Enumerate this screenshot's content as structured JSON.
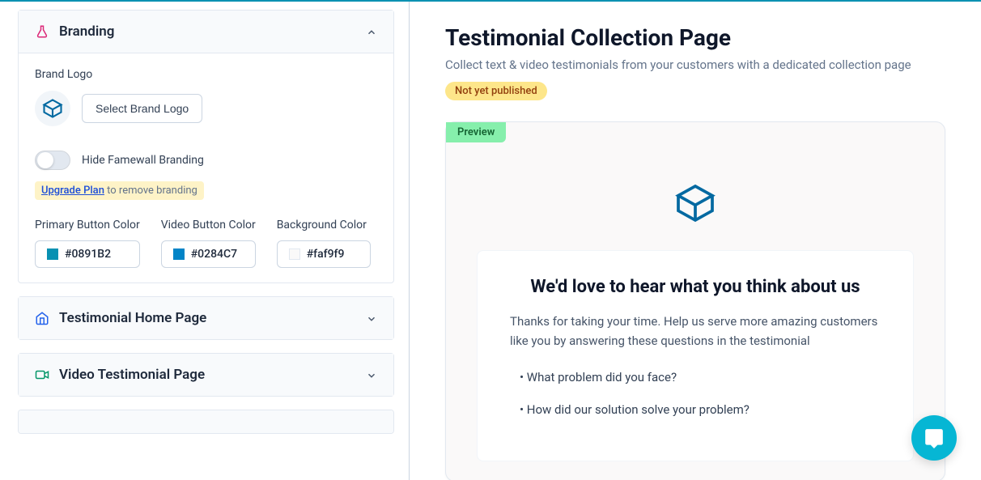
{
  "leftPanel": {
    "sections": {
      "branding": {
        "title": "Branding",
        "brandLogoLabel": "Brand Logo",
        "selectLogoButton": "Select Brand Logo",
        "hideBrandingLabel": "Hide Famewall Branding",
        "upgradeLink": "Upgrade Plan",
        "upgradeRest": " to remove branding",
        "colors": {
          "primary": {
            "label": "Primary Button Color",
            "value": "#0891B2",
            "swatch": "#0891B2"
          },
          "video": {
            "label": "Video Button Color",
            "value": "#0284C7",
            "swatch": "#0284C7"
          },
          "background": {
            "label": "Background Color",
            "value": "#faf9f9",
            "swatch": "#faf9f9"
          }
        }
      },
      "testimonialHome": {
        "title": "Testimonial Home Page"
      },
      "videoTestimonial": {
        "title": "Video Testimonial Page"
      }
    }
  },
  "rightPanel": {
    "title": "Testimonial Collection Page",
    "subtitle": "Collect text & video testimonials from your customers with a dedicated collection page",
    "statusBadge": "Not yet published",
    "preview": {
      "badge": "Preview",
      "heading": "We'd love to hear what you think about us",
      "description": "Thanks for taking your time. Help us serve more amazing customers like you by answering these questions in the testimonial",
      "questions": [
        "• What problem did you face?",
        "• How did our solution solve your problem?"
      ]
    }
  }
}
